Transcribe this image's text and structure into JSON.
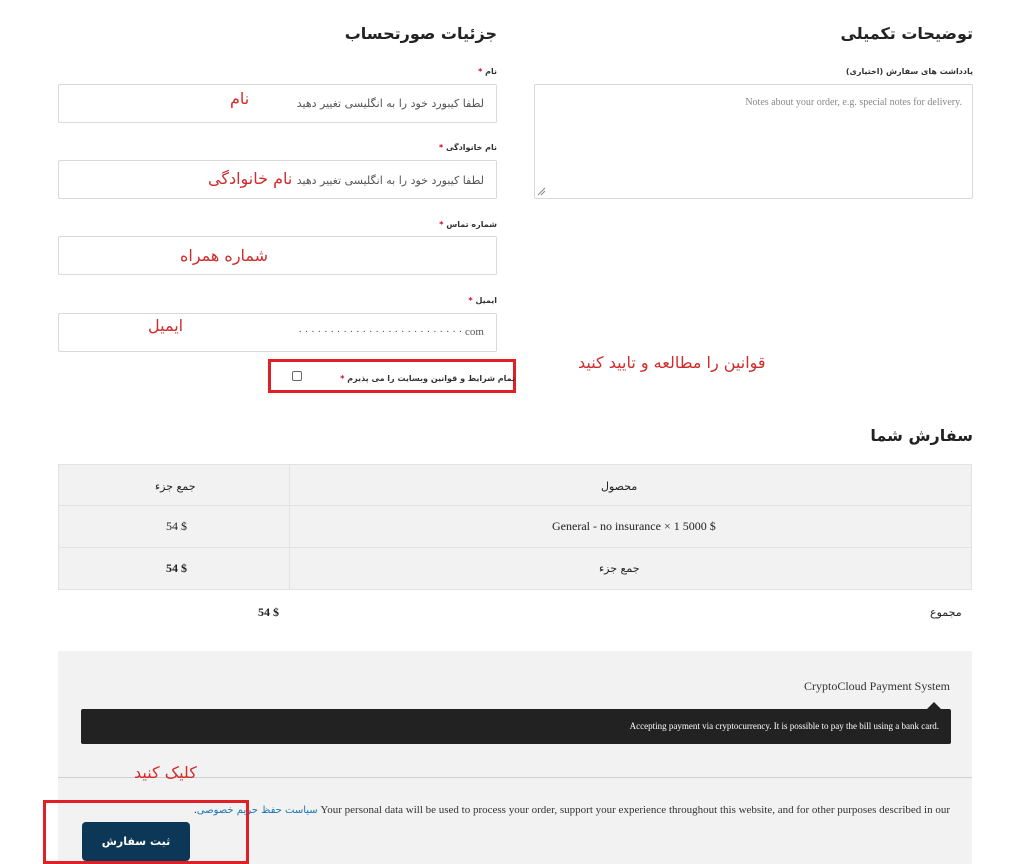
{
  "additional": {
    "title": "توضیحات تکمیلی",
    "notes_label": "یادداشت های سفارش (اختیاری)",
    "notes_placeholder": "Notes about your order, e.g. special notes for delivery."
  },
  "billing": {
    "title": "جزئیات صورتحساب",
    "first_name": {
      "label": "نام",
      "required": "*",
      "value": "لطفا کیبورد خود را به انگلیسی تغییر دهید"
    },
    "last_name": {
      "label": "نام خانوادگی",
      "required": "*",
      "value": "لطفا کیبورد خود را به انگلیسی تغییر دهید"
    },
    "phone": {
      "label": "شماره تماس",
      "required": "*",
      "value": ""
    },
    "email": {
      "label": "ایمیل",
      "required": "*",
      "value": "· · · · · · · · · · · · · · · · · · · · · · · · · · com"
    },
    "terms": {
      "label": "تمام شرایط و قوانین وبسایت را می پذیرم",
      "required": "*"
    }
  },
  "annotations": {
    "name": "نام",
    "last_name": "نام خانوادگی",
    "phone": "شماره همراه",
    "email": "ایمیل",
    "terms": "قوانین را مطالعه و تایید کنید",
    "click": "کلیک کنید"
  },
  "order": {
    "title": "سفارش شما",
    "col_product": "محصول",
    "col_subtotal": "جمع جزء",
    "item_name": "General - no insurance",
    "item_qty": "× 1",
    "item_price": "5000 $",
    "item_total": "54 $",
    "subtotal_label": "جمع جزء",
    "subtotal_value": "54 $",
    "total_label": "مجموع",
    "total_value": "54 $"
  },
  "payment": {
    "method_name": "CryptoCloud Payment System",
    "method_desc": "Accepting payment via cryptocurrency. It is possible to pay the bill using a bank card.",
    "privacy_text": "Your personal data will be used to process your order, support your experience throughout this website, and for other purposes described in our",
    "privacy_link": "سیاست حفظ حریم خصوصی",
    "privacy_dot": ".",
    "place_order": "ثبت سفارش"
  },
  "colors": {
    "accent": "#0d3756",
    "annotation": "#e11f26",
    "link": "#1a73b8"
  }
}
